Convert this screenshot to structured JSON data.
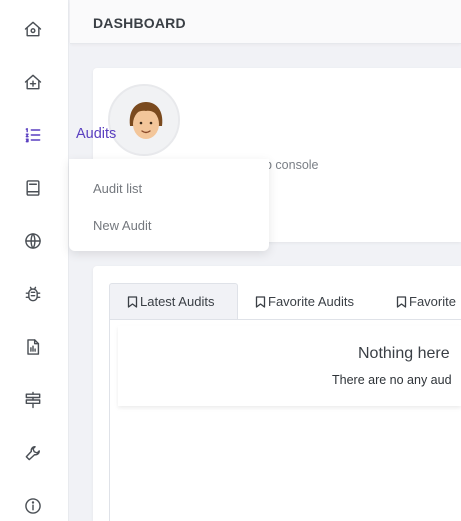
{
  "topbar": {
    "title": "DASHBOARD"
  },
  "sidebar": {
    "items": [
      {
        "icon": "home-icon"
      },
      {
        "icon": "home-plus-icon"
      },
      {
        "icon": "list-numbered-icon",
        "active": true
      },
      {
        "icon": "book-icon"
      },
      {
        "icon": "globe-icon"
      },
      {
        "icon": "bug-icon"
      },
      {
        "icon": "report-icon"
      },
      {
        "icon": "signpost-icon"
      },
      {
        "icon": "wrench-icon"
      },
      {
        "icon": "info-icon"
      }
    ]
  },
  "flyout": {
    "title": "Audits",
    "items": [
      {
        "label": "Audit list"
      },
      {
        "label": "New Audit"
      }
    ]
  },
  "profile_card": {
    "subtitle": "b console"
  },
  "tabs": [
    {
      "label": "Latest Audits",
      "active": true
    },
    {
      "label": "Favorite Audits"
    },
    {
      "label": "Favorite"
    }
  ],
  "empty_state": {
    "title": "Nothing here",
    "message": "There are no any aud"
  },
  "colors": {
    "accent": "#5a3fc0",
    "background": "#f1f2f6"
  }
}
